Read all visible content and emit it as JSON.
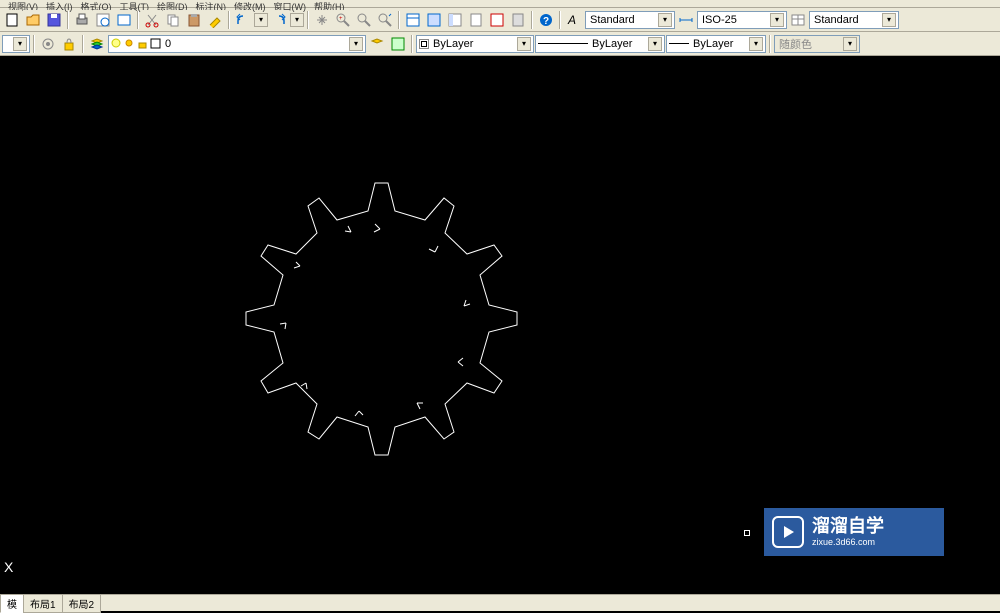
{
  "menu": {
    "items": [
      "视图(V)",
      "插入(I)",
      "格式(O)",
      "工具(T)",
      "绘图(D)",
      "标注(N)",
      "修改(M)",
      "窗口(W)",
      "帮助(H)"
    ]
  },
  "toolbar1": {
    "styles": {
      "textStyle": "Standard",
      "dimStyle": "ISO-25",
      "tableStyle": "Standard"
    }
  },
  "toolbar2": {
    "layerDropdown": "0",
    "colorDropdown": "ByLayer",
    "linetypeDropdown": "ByLayer",
    "lineweightDropdown": "ByLayer",
    "plotStyleDropdown": "随颜色"
  },
  "canvas": {
    "ucsLabel": "X"
  },
  "watermark": {
    "cn": "溜溜自学",
    "en": "zixue.3d66.com"
  },
  "tabs": {
    "model": "模",
    "layout1": "布局1",
    "layout2": "布局2"
  },
  "icons": {
    "new": "new-icon",
    "open": "open-icon",
    "save": "save-icon",
    "cut": "cut-icon",
    "copy": "copy-icon",
    "paste": "paste-icon",
    "undo": "undo-icon",
    "redo": "redo-icon",
    "pan": "pan-icon",
    "zoom": "zoom-icon",
    "help": "help-icon"
  }
}
